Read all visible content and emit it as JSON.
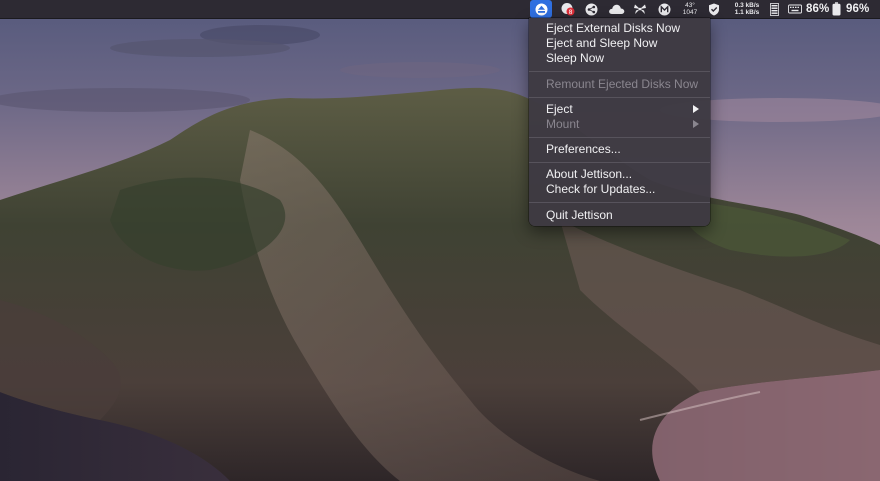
{
  "menubar": {
    "icons": [
      "jettison-eject-icon",
      "record-badge-icon",
      "network-share-icon",
      "cloud-icon",
      "butterfly-icon",
      "m-badge-icon"
    ],
    "weather": {
      "temp": "43°",
      "value": "1047"
    },
    "network": {
      "up": "0.3 kB/s",
      "down": "1.1 kB/s"
    },
    "keyboard_battery": "86%",
    "battery": "96%"
  },
  "menu": {
    "items": [
      {
        "label": "Eject External Disks Now",
        "enabled": true
      },
      {
        "label": "Eject and Sleep Now",
        "enabled": true
      },
      {
        "label": "Sleep Now",
        "enabled": true
      },
      {
        "label": "Remount Ejected Disks Now",
        "enabled": false
      },
      {
        "label": "Eject",
        "enabled": true,
        "submenu": true
      },
      {
        "label": "Mount",
        "enabled": false,
        "submenu": true
      },
      {
        "label": "Preferences...",
        "enabled": true
      },
      {
        "label": "About Jettison...",
        "enabled": true
      },
      {
        "label": "Check for Updates...",
        "enabled": true
      },
      {
        "label": "Quit Jettison",
        "enabled": true
      }
    ]
  },
  "colors": {
    "menubar_bg": "#2d2a33",
    "menu_bg": "#3e3a42",
    "active_accent": "#2f6fe0",
    "disabled_text": "#8a868f"
  }
}
